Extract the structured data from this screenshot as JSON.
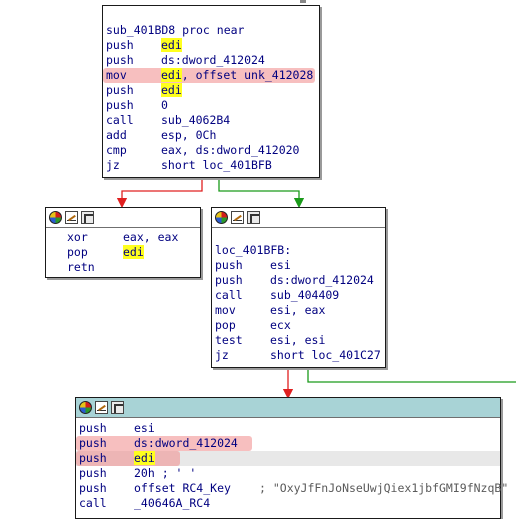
{
  "node_main": {
    "label": "sub_401BD8 proc near",
    "lines": [
      {
        "m": "push",
        "o": "edi",
        "hl": "edi"
      },
      {
        "m": "push",
        "o": "ds:dword_412024"
      },
      {
        "m": "mov",
        "o": "edi, offset unk_412028",
        "hl": "edi"
      },
      {
        "m": "push",
        "o": "edi",
        "hl": "edi"
      },
      {
        "m": "push",
        "o": "0"
      },
      {
        "m": "call",
        "o": "sub_4062B4"
      },
      {
        "m": "add",
        "o": "esp, 0Ch"
      },
      {
        "m": "cmp",
        "o": "eax, ds:dword_412020"
      },
      {
        "m": "jz",
        "o": "short loc_401BFB"
      }
    ]
  },
  "node_left": {
    "lines": [
      {
        "m": "xor",
        "o": "eax, eax"
      },
      {
        "m": "pop",
        "o": "edi",
        "hl": "edi"
      },
      {
        "m": "retn",
        "o": ""
      }
    ]
  },
  "node_right": {
    "label": "loc_401BFB:",
    "lines": [
      {
        "m": "push",
        "o": "esi"
      },
      {
        "m": "push",
        "o": "ds:dword_412024"
      },
      {
        "m": "call",
        "o": "sub_404409"
      },
      {
        "m": "mov",
        "o": "esi, eax"
      },
      {
        "m": "pop",
        "o": "ecx"
      },
      {
        "m": "test",
        "o": "esi, esi"
      },
      {
        "m": "jz",
        "o": "short loc_401C27"
      }
    ]
  },
  "node_bottom": {
    "lines": [
      {
        "m": "push",
        "o": "esi"
      },
      {
        "m": "push",
        "o": "ds:dword_412024"
      },
      {
        "m": "push",
        "o": "edi",
        "hl": "edi"
      },
      {
        "m": "push",
        "o": "20h ; ' '"
      },
      {
        "m": "push",
        "o": "offset RC4_Key",
        "c": "; \"OxyJfFnJoNseUwjQiex1jbfGMI9fNzqB\""
      },
      {
        "m": "call",
        "o": "_40646A_RC4"
      }
    ]
  },
  "colors": {
    "edge_false": "#e02020",
    "edge_true": "#1a9a1a",
    "selected_header": "#a8d3d6",
    "highlight": "#ffff1e",
    "annotation": "#f08a8a"
  },
  "header_icons": [
    "color-wheel-icon",
    "edit-pencil-icon",
    "graph-view-icon"
  ]
}
